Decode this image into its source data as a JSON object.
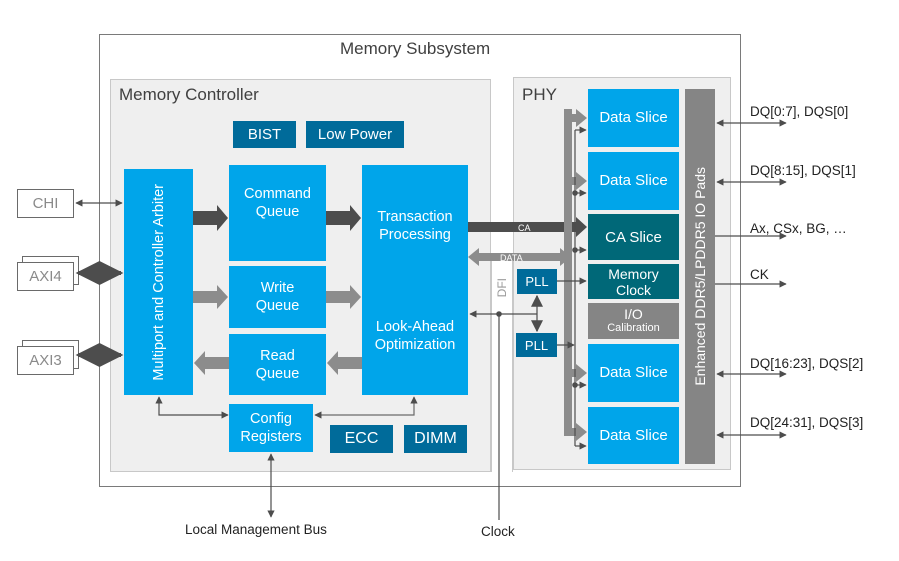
{
  "subsystem": {
    "title": "Memory Subsystem"
  },
  "controller": {
    "title": "Memory Controller",
    "bist": "BIST",
    "low_power": "Low Power",
    "arbiter": "Multiport and Controller Arbiter",
    "command_queue": [
      "Command",
      "Queue"
    ],
    "write_queue": [
      "Write",
      "Queue"
    ],
    "read_queue": [
      "Read",
      "Queue"
    ],
    "transaction": [
      "Transaction",
      "Processing"
    ],
    "lookahead": [
      "Look-Ahead",
      "Optimization"
    ],
    "config": [
      "Config",
      "Registers"
    ],
    "ecc": "ECC",
    "dimm": "DIMM"
  },
  "ports": [
    "CHI",
    "AXI4",
    "AXI3"
  ],
  "dfi": {
    "label": "DFI",
    "ca": "CA",
    "data": "DATA",
    "pll": "PLL"
  },
  "phy": {
    "title": "PHY",
    "data_slice": "Data Slice",
    "ca_slice": "CA Slice",
    "memory_clock": [
      "Memory",
      "Clock"
    ],
    "io_cal": [
      "I/O",
      "Calibration"
    ],
    "pads": "Enhanced DDR5/LPDDR5 IO Pads"
  },
  "signals": [
    "DQ[0:7], DQS[0]",
    "DQ[8:15], DQS[1]",
    "Ax, CSx, BG, …",
    "CK",
    "DQ[16:23], DQS[2]",
    "DQ[24:31], DQS[3]"
  ],
  "external": {
    "local_bus": "Local Management Bus",
    "clock": "Clock"
  },
  "colors": {
    "blue": "#00a5ea",
    "dark_blue": "#006b9a",
    "teal": "#006878",
    "gray": "#858585",
    "arrow_dark": "#4d4d4d",
    "arrow_light": "#8c8c8c"
  }
}
